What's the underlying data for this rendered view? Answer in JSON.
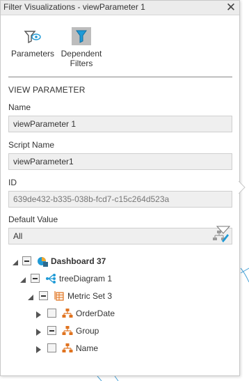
{
  "window": {
    "title": "Filter Visualizations - viewParameter 1",
    "close_icon": "close-icon"
  },
  "toolbar": {
    "parameters": {
      "label": "Parameters",
      "icon": "filter-eye-icon"
    },
    "dependent_filters": {
      "label_line1": "Dependent",
      "label_line2": "Filters",
      "icon": "filter-icon",
      "active": true
    }
  },
  "section": {
    "title": "VIEW PARAMETER"
  },
  "fields": {
    "name": {
      "label": "Name",
      "value": "viewParameter 1"
    },
    "script_name": {
      "label": "Script Name",
      "value": "viewParameter1"
    },
    "id": {
      "label": "ID",
      "value": "639de432-b335-038b-fcd7-c15c264d523a"
    },
    "default_value": {
      "label": "Default Value",
      "value": "All",
      "icon": "hierarchy-edit-icon"
    }
  },
  "tree": {
    "dashboard": {
      "label": "Dashboard 37",
      "icon": "dashboard-icon",
      "expanded": true,
      "check_state": "partial"
    },
    "tree_diagram": {
      "label": "treeDiagram 1",
      "icon": "tree-diagram-icon",
      "expanded": true,
      "check_state": "partial"
    },
    "metric_set": {
      "label": "Metric Set 3",
      "icon": "metric-set-icon",
      "expanded": true,
      "check_state": "partial"
    },
    "hierarchies": [
      {
        "label": "OrderDate",
        "icon": "hierarchy-icon",
        "check_state": "unchecked"
      },
      {
        "label": "Group",
        "icon": "hierarchy-icon",
        "check_state": "partial"
      },
      {
        "label": "Name",
        "icon": "hierarchy-icon",
        "check_state": "unchecked"
      }
    ]
  },
  "colors": {
    "accent": "#1f9ad6",
    "orange": "#e0731f",
    "panel_border": "#c8c8c8"
  }
}
